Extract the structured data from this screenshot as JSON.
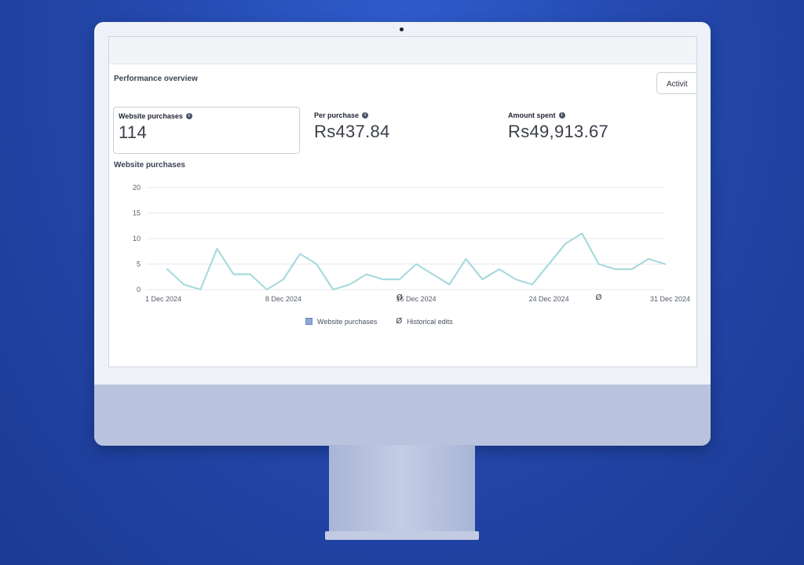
{
  "header": {
    "title": "Performance overview",
    "activity_button": "Activit"
  },
  "metrics": [
    {
      "label": "Website purchases",
      "value": "114"
    },
    {
      "label": "Per purchase",
      "value": "Rs437.84"
    },
    {
      "label": "Amount spent",
      "value": "Rs49,913.67"
    }
  ],
  "chart_title": "Website purchases",
  "legend": {
    "series_label": "Website purchases",
    "edits_label": "Historical edits",
    "edit_marker": "Ø"
  },
  "colors": {
    "line": "#a9dadd",
    "background": "#2448ad",
    "monitor": "#eef1f8"
  },
  "chart_data": {
    "type": "line",
    "title": "Website purchases",
    "ylim": [
      0,
      20
    ],
    "yticks": [
      0,
      5,
      10,
      15,
      20
    ],
    "grid": true,
    "xtick_labels": [
      "1 Dec 2024",
      "8 Dec 2024",
      "16 Dec 2024",
      "24 Dec 2024",
      "31 Dec 2024"
    ],
    "xtick_index": [
      0,
      7,
      15,
      23,
      30
    ],
    "series": [
      {
        "name": "Website purchases",
        "values": [
          4,
          1,
          0,
          8,
          3,
          3,
          0,
          2,
          7,
          5,
          0,
          1,
          3,
          2,
          2,
          5,
          3,
          1,
          6,
          2,
          4,
          2,
          1,
          5,
          9,
          11,
          5,
          4,
          4,
          6,
          5
        ]
      }
    ],
    "historical_edit_index": [
      14,
      26
    ],
    "legend": "bottom"
  }
}
